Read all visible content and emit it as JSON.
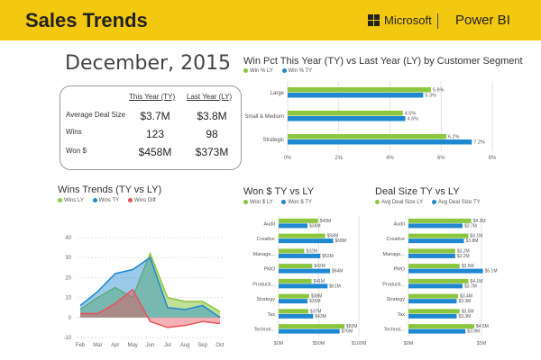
{
  "header": {
    "title": "Sales Trends",
    "brand": "Microsoft",
    "product": "Power BI",
    "bg_color": "#F2C811"
  },
  "date_heading": "December, 2015",
  "kpi": {
    "col_ty": "This Year (TY)",
    "col_ly": "Last Year (LY)",
    "rows": [
      {
        "label": "Average Deal Size",
        "ty": "$3.7M",
        "ly": "$3.8M"
      },
      {
        "label": "Wins",
        "ty": "123",
        "ly": "98"
      },
      {
        "label": "Won $",
        "ty": "$458M",
        "ly": "$373M"
      }
    ]
  },
  "colors": {
    "green": "#8CC63F",
    "blue": "#1E88D0",
    "red": "#E8525A"
  },
  "chart_data": [
    {
      "type": "bar",
      "orientation": "horizontal",
      "title": "Win Pct This Year (TY) vs Last Year (LY)  by Customer Segment",
      "categories": [
        "Large",
        "Small & Medium",
        "Strategic"
      ],
      "series": [
        {
          "name": "Win % LY",
          "values": [
            5.6,
            4.5,
            6.2
          ],
          "labels": [
            "5.6%",
            "4.5%",
            "6.2%"
          ]
        },
        {
          "name": "Win % TY",
          "values": [
            5.3,
            4.6,
            7.2
          ],
          "labels": [
            "5.3%",
            "4.6%",
            "7.2%"
          ]
        }
      ],
      "xlim": [
        0,
        8
      ],
      "xticks": [
        "0%",
        "2%",
        "4%",
        "6%",
        "8%"
      ],
      "xtick_values": [
        0,
        2,
        4,
        6,
        8
      ]
    },
    {
      "type": "area",
      "title": "Wins Trends (TY vs LY)",
      "categories": [
        "Feb",
        "Mar",
        "Apr",
        "May",
        "Jun",
        "Jul",
        "Aug",
        "Sep",
        "Oct"
      ],
      "series": [
        {
          "name": "Wins LY",
          "values": [
            4,
            10,
            15,
            10,
            32,
            10,
            8,
            8,
            3
          ]
        },
        {
          "name": "Wins TY",
          "values": [
            6,
            13,
            22,
            24,
            30,
            5,
            4,
            6,
            0
          ]
        },
        {
          "name": "Wins Diff",
          "values": [
            2,
            2,
            7,
            14,
            -2,
            -5,
            -4,
            -2,
            -3
          ]
        }
      ],
      "ylim": [
        -10,
        40
      ],
      "yticks": [
        "40",
        "30",
        "20",
        "10",
        "0",
        "-10"
      ],
      "ytick_values": [
        40,
        30,
        20,
        10,
        0,
        -10
      ]
    },
    {
      "type": "bar",
      "orientation": "horizontal",
      "title": "Won $ TY vs LY",
      "categories": [
        "Audit",
        "Creative",
        "Manage...",
        "PMO",
        "Producti...",
        "Strategy",
        "Tax",
        "Technol..."
      ],
      "series": [
        {
          "name": "Won $ LY",
          "values": [
            49,
            58,
            32,
            42,
            41,
            38,
            37,
            82
          ],
          "labels": [
            "$49M",
            "$58M",
            "$32M",
            "$42M",
            "$41M",
            "$38M",
            "$37M",
            "$82M"
          ]
        },
        {
          "name": "Won $ TY",
          "values": [
            36,
            68,
            52,
            64,
            61,
            36,
            43,
            76
          ],
          "labels": [
            "$36M",
            "$68M",
            "$52M",
            "$64M",
            "$61M",
            "$36M",
            "$43M",
            "$76M"
          ]
        }
      ],
      "xlim": [
        0,
        100
      ],
      "xticks": [
        "$0M",
        "$50M",
        "$100M"
      ],
      "xtick_values": [
        0,
        50,
        100
      ]
    },
    {
      "type": "bar",
      "orientation": "horizontal",
      "title": "Deal Size TY vs LY",
      "categories": [
        "Audit",
        "Creative",
        "Manage...",
        "PMO",
        "Producti...",
        "Strategy",
        "Tax",
        "Technol..."
      ],
      "series": [
        {
          "name": "Avg Deal Size LY",
          "values": [
            4.3,
            4.1,
            3.2,
            3.5,
            4.1,
            3.4,
            3.5,
            4.5
          ],
          "labels": [
            "$4.3M",
            "$4.1M",
            "$3.2M",
            "$3.5M",
            "$4.1M",
            "$3.4M",
            "$3.5M",
            "$4.5M"
          ]
        },
        {
          "name": "Avg Deal Size TY",
          "values": [
            3.7,
            3.8,
            3.2,
            5.1,
            3.7,
            3.3,
            3.3,
            3.9
          ],
          "labels": [
            "$3.7M",
            "$3.8M",
            "$3.2M",
            "$5.1M",
            "$3.7M",
            "$3.3M",
            "$3.3M",
            "$3.9M"
          ]
        }
      ],
      "xlim": [
        0,
        5
      ],
      "xticks": [
        "$0M",
        "$5M"
      ],
      "xtick_values": [
        0,
        5
      ]
    }
  ]
}
